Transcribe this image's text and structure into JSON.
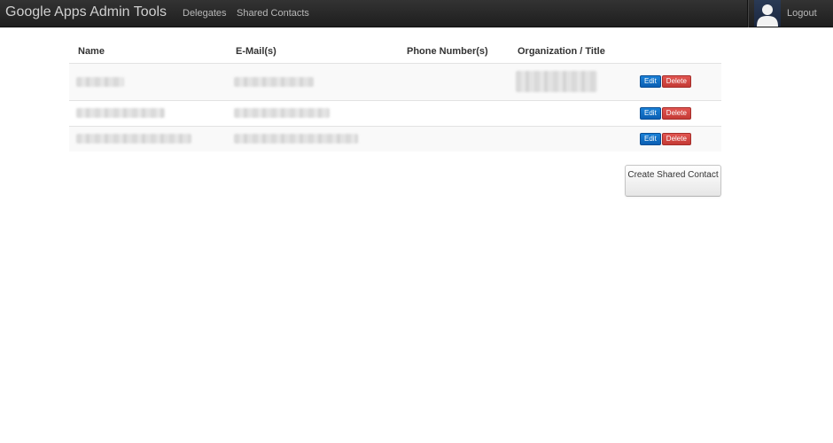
{
  "navbar": {
    "brand": "Google Apps Admin Tools",
    "links": [
      {
        "label": "Delegates"
      },
      {
        "label": "Shared Contacts"
      }
    ],
    "user_icon": "user-avatar-icon",
    "logout_label": "Logout"
  },
  "table": {
    "headers": [
      "Name",
      "E-Mail(s)",
      "Phone Number(s)",
      "Organization / Title",
      ""
    ],
    "rows": [
      {
        "name": "",
        "email": "",
        "phone": "",
        "organization": "",
        "edit_label": "Edit",
        "delete_label": "Delete"
      },
      {
        "name": "",
        "email": "",
        "phone": "",
        "organization": "",
        "edit_label": "Edit",
        "delete_label": "Delete"
      },
      {
        "name": "",
        "email": "",
        "phone": "",
        "organization": "",
        "edit_label": "Edit",
        "delete_label": "Delete"
      }
    ]
  },
  "create_button_label": "Create Shared Contact",
  "colors": {
    "navbar": "#222222",
    "edit_button": "#0b6dc7",
    "delete_button": "#d5463f"
  }
}
